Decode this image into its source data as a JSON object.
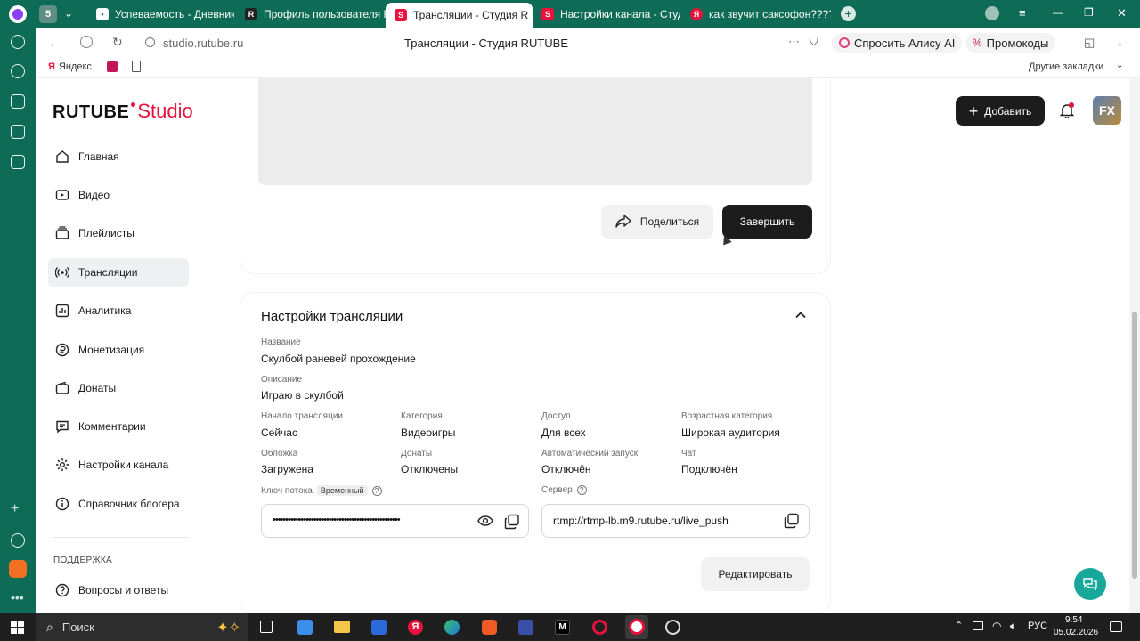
{
  "browser": {
    "tabs": [
      {
        "label": "Успеваемость - Дневник"
      },
      {
        "label": "Профиль пользователя R"
      },
      {
        "label": "Трансляции - Студия R"
      },
      {
        "label": "Настройки канала - Студ"
      },
      {
        "label": "как звучит саксофон????"
      }
    ],
    "tab_counter": "5",
    "url": "studio.rutube.ru",
    "page_title": "Трансляции - Студия RUTUBE",
    "alice_label": "Спросить Алису AI",
    "promo_label": "Промокоды",
    "bookmarks": {
      "yandex": "Яндекс",
      "other": "Другие закладки"
    }
  },
  "header": {
    "logo_main": "RUTUBE",
    "logo_sub": "Studio",
    "add_label": "Добавить",
    "avatar_text": "FX"
  },
  "sidebar": {
    "items": [
      {
        "label": "Главная"
      },
      {
        "label": "Видео"
      },
      {
        "label": "Плейлисты"
      },
      {
        "label": "Трансляции"
      },
      {
        "label": "Аналитика"
      },
      {
        "label": "Монетизация"
      },
      {
        "label": "Донаты"
      },
      {
        "label": "Комментарии"
      },
      {
        "label": "Настройки канала"
      },
      {
        "label": "Справочник блогера"
      }
    ],
    "support_heading": "ПОДДЕРЖКА",
    "faq_label": "Вопросы и ответы"
  },
  "player_card": {
    "share_label": "Поделиться",
    "finish_label": "Завершить"
  },
  "settings": {
    "title": "Настройки трансляции",
    "name_label": "Название",
    "name_value": "Скулбой раневей прохождение",
    "desc_label": "Описание",
    "desc_value": "Играю в скулбой",
    "start_label": "Начало трансляции",
    "start_value": "Сейчас",
    "category_label": "Категория",
    "category_value": "Видеоигры",
    "access_label": "Доступ",
    "access_value": "Для всех",
    "age_label": "Возрастная категория",
    "age_value": "Широкая аудитория",
    "cover_label": "Обложка",
    "cover_value": "Загружена",
    "donates_label": "Донаты",
    "donates_value": "Отключены",
    "autostart_label": "Автоматический запуск",
    "autostart_value": "Отключён",
    "chat_label": "Чат",
    "chat_value": "Подключён",
    "key_label": "Ключ потока",
    "key_badge": "Временный",
    "key_value": "••••••••••••••••••••••••••••••••••••••••••••••••••",
    "server_label": "Сервер",
    "server_value": "rtmp://rtmp-lb.m9.rutube.ru/live_push",
    "edit_label": "Редактировать"
  },
  "taskbar": {
    "search_placeholder": "Поиск",
    "lang": "РУС",
    "time": "9:54",
    "date": "05.02.2026"
  },
  "colors": {
    "accent_red": "#e8123c",
    "chrome_green": "#0e6b56",
    "help_teal": "#18a79b"
  }
}
